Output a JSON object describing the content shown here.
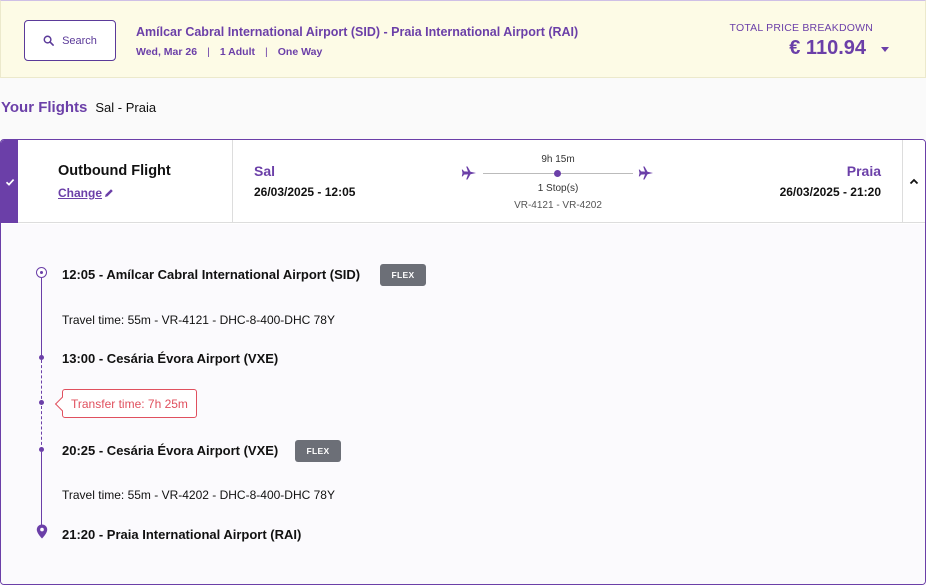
{
  "summary": {
    "search_label": "Search",
    "route_title": "Amílcar Cabral International Airport (SID) - Praia International Airport (RAI)",
    "date": "Wed, Mar 26",
    "passengers": "1 Adult",
    "trip_type": "One Way",
    "separator": "|",
    "price_label": "TOTAL PRICE BREAKDOWN",
    "price_value": "€ 110.94"
  },
  "flights_heading": {
    "label": "Your Flights",
    "route": "Sal - Praia"
  },
  "outbound": {
    "title": "Outbound Flight",
    "change_label": "Change",
    "departure_city": "Sal",
    "departure_datetime": "26/03/2025 - 12:05",
    "arrival_city": "Praia",
    "arrival_datetime": "26/03/2025 - 21:20",
    "duration": "9h 15m",
    "stops": "1 Stop(s)",
    "flight_numbers": "VR-4121 - VR-4202"
  },
  "itinerary": {
    "stop1": "12:05 - Amílcar Cabral International Airport (SID)",
    "flex1": "FLEX",
    "segment1": "Travel time: 55m - VR-4121 - DHC-8-400-DHC 78Y",
    "stop2": "13:00 - Cesária Évora Airport (VXE)",
    "transfer": "Transfer time: 7h 25m",
    "stop3": "20:25 - Cesária Évora Airport (VXE)",
    "flex2": "FLEX",
    "segment2": "Travel time: 55m - VR-4202 - DHC-8-400-DHC 78Y",
    "stop4": "21:20 - Praia International Airport (RAI)"
  },
  "colors": {
    "brand": "#6b3fa8",
    "summary_bg": "#fdfbe6",
    "transfer_red": "#e0505e",
    "flex_badge": "#6c6f77"
  }
}
